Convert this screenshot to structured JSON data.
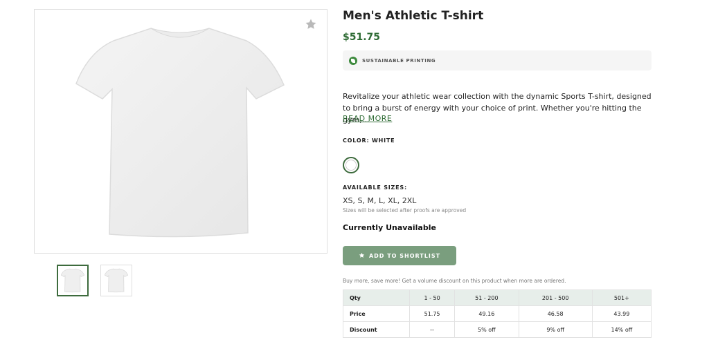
{
  "product": {
    "title": "Men's Athletic T-shirt",
    "price": "$51.75",
    "badge": "SUSTAINABLE PRINTING",
    "description": "Revitalize your athletic wear collection with the dynamic Sports T-shirt, designed to bring a burst of energy with your choice of print. Whether you're hitting the gym,…",
    "read_more": "READ MORE",
    "color_label": "COLOR: WHITE",
    "color_swatch": "#ffffff",
    "sizes_label": "AVAILABLE SIZES:",
    "sizes": "XS, S, M, L, XL, 2XL",
    "sizes_note": "Sizes will be selected after proofs are approved",
    "availability": "Currently Unavailable",
    "shortlist_label": "ADD TO SHORTLIST"
  },
  "gallery": {
    "favorite_icon": "star-icon",
    "thumbnails": [
      "front-view",
      "back-view"
    ],
    "active_thumbnail": 0
  },
  "bulk": {
    "note": "Buy more, save more! Get a volume discount on this product when more are ordered.",
    "headers": [
      "Qty",
      "1 - 50",
      "51 - 200",
      "201 - 500",
      "501+"
    ],
    "rows": [
      [
        "Price",
        "51.75",
        "49.16",
        "46.58",
        "43.99"
      ],
      [
        "Discount",
        "--",
        "5% off",
        "9% off",
        "14% off"
      ]
    ]
  },
  "colors": {
    "accent": "#2e6b34",
    "button": "#7a9e7e",
    "table_header": "#e7eeea"
  }
}
